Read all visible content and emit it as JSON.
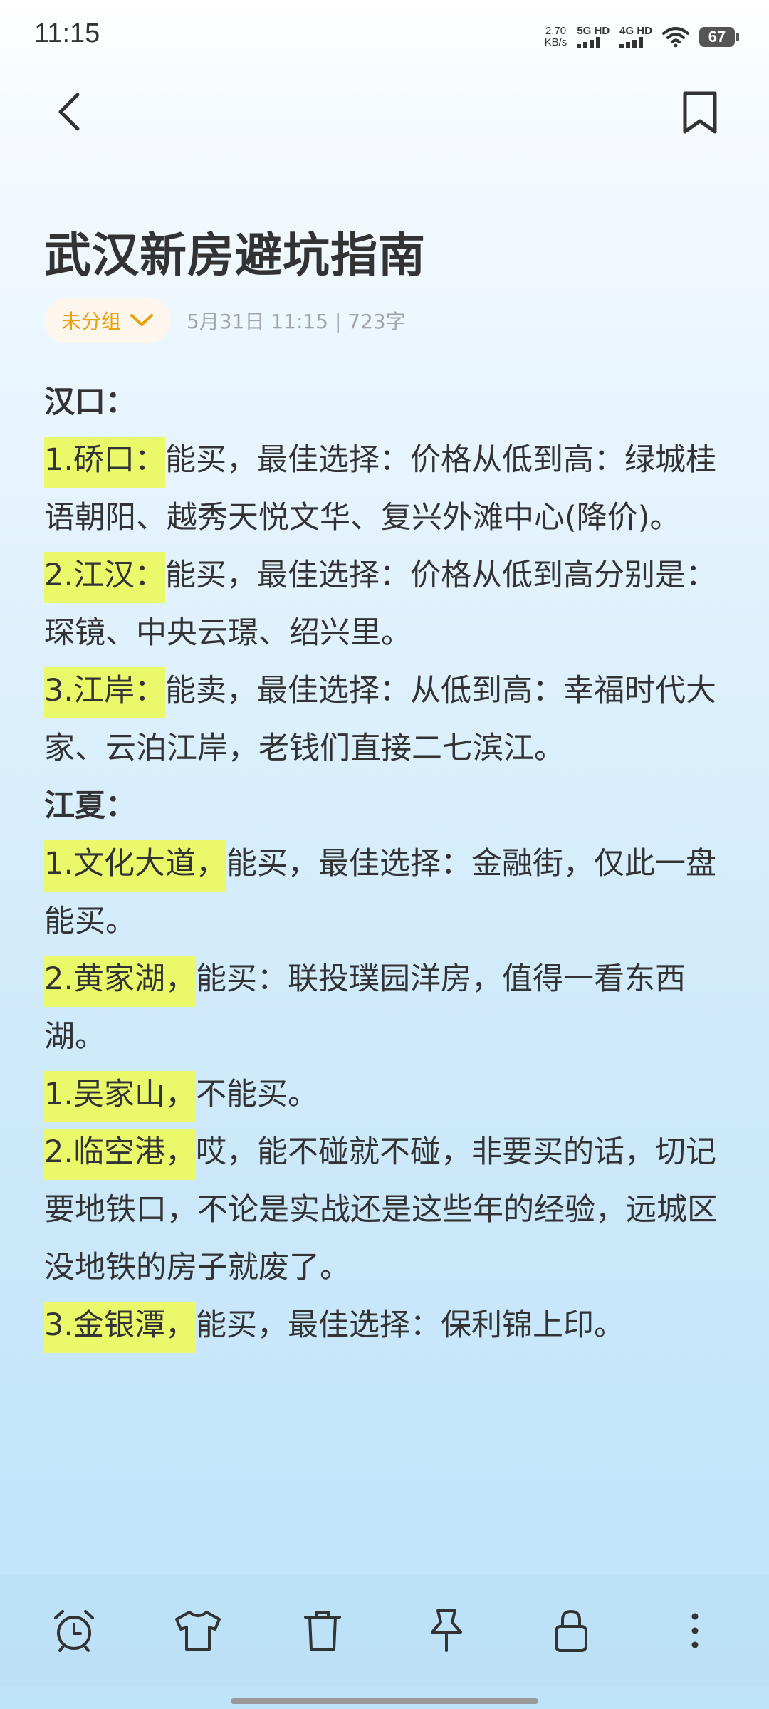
{
  "status_bar": {
    "time": "11:15",
    "net_speed_value": "2.70",
    "net_speed_unit": "KB/s",
    "sim1_label": "5G HD",
    "sim2_label": "4G HD",
    "battery": "67"
  },
  "note": {
    "title": "武汉新房避坑指南",
    "group_label": "未分组",
    "meta": "5月31日 11:15  |  723字"
  },
  "content": {
    "section1": "汉口：",
    "p1_highlight": "1.硚口：",
    "p1_text": "能买，最佳选择：价格从低到高：绿城桂语朝阳、越秀天悦文华、复兴外滩中心(降价)。",
    "p2_highlight": "2.江汉：",
    "p2_text": "能买，最佳选择：价格从低到高分别是：琛镜、中央云璟、绍兴里。",
    "p3_highlight": "3.江岸：",
    "p3_text": "能卖，最佳选择：从低到高：幸福时代大家、云泊江岸，老钱们直接二七滨江。",
    "section2": "江夏：",
    "p4_highlight": "1.文化大道，",
    "p4_text": "能买，最佳选择：金融街，仅此一盘能买。",
    "p5_highlight": "2.黄家湖，",
    "p5_text": "能买：联投璞园洋房，值得一看东西湖。",
    "p6_highlight": "1.吴家山，",
    "p6_text": "不能买。",
    "p7_highlight": "2.临空港，",
    "p7_text": "哎，能不碰就不碰，非要买的话，切记要地铁口，不论是实战还是这些年的经验，远城区没地铁的房子就废了。",
    "p8_highlight": "3.金银潭，",
    "p8_text": "能买，最佳选择：保利锦上印。"
  },
  "toolbar": {
    "icons": [
      "alarm-clock-icon",
      "shirt-icon",
      "trash-icon",
      "pin-icon",
      "lock-icon",
      "more-icon"
    ]
  },
  "colors": {
    "highlight": "#eaf96a",
    "group_accent": "#e8a20b",
    "meta_gray": "#a0a4a8"
  }
}
